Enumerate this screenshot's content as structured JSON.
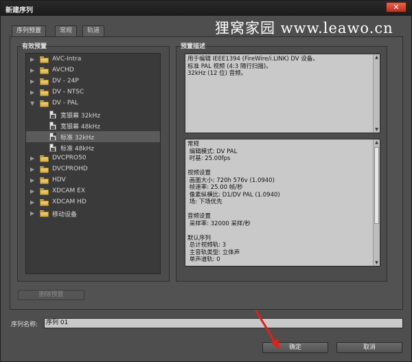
{
  "window": {
    "title": "新建序列",
    "close_label": "✕",
    "watermark": "狸窝家园  www.leawo.cn"
  },
  "tabs": [
    {
      "label": "序列预置",
      "active": true
    },
    {
      "label": "常规",
      "active": false
    },
    {
      "label": "轨道",
      "active": false
    }
  ],
  "presets": {
    "group_label": "有效预置",
    "items": [
      {
        "label": "AVC-Intra",
        "type": "folder",
        "expanded": false,
        "level": 0
      },
      {
        "label": "AVCHD",
        "type": "folder",
        "expanded": false,
        "level": 0
      },
      {
        "label": "DV - 24P",
        "type": "folder",
        "expanded": false,
        "level": 0
      },
      {
        "label": "DV - NTSC",
        "type": "folder",
        "expanded": false,
        "level": 0
      },
      {
        "label": "DV - PAL",
        "type": "folder",
        "expanded": true,
        "level": 0
      },
      {
        "label": "宽银幕 32kHz",
        "type": "file",
        "level": 1
      },
      {
        "label": "宽银幕 48kHz",
        "type": "file",
        "level": 1
      },
      {
        "label": "标准 32kHz",
        "type": "file",
        "level": 1,
        "selected": true
      },
      {
        "label": "标准 48kHz",
        "type": "file",
        "level": 1
      },
      {
        "label": "DVCPRO50",
        "type": "folder",
        "expanded": false,
        "level": 0
      },
      {
        "label": "DVCPROHD",
        "type": "folder",
        "expanded": false,
        "level": 0
      },
      {
        "label": "HDV",
        "type": "folder",
        "expanded": false,
        "level": 0
      },
      {
        "label": "XDCAM EX",
        "type": "folder",
        "expanded": false,
        "level": 0
      },
      {
        "label": "XDCAM HD",
        "type": "folder",
        "expanded": false,
        "level": 0
      },
      {
        "label": "移动设备",
        "type": "folder",
        "expanded": false,
        "level": 0
      }
    ],
    "delete_button": "删除预置"
  },
  "description": {
    "group_label": "预置描述",
    "summary_lines": [
      "用于编辑 IEEE1394 (FireWire/i.LINK) DV 设备。",
      "标准 PAL 视频 (4:3 隔行扫描)。",
      "32kHz (12 位) 音频。"
    ],
    "detail_lines": [
      "常规",
      " 编辑模式: DV PAL",
      " 时基: 25.00fps",
      "",
      "视频设置",
      " 画面大小: 720h 576v (1.0940)",
      " 帧速率: 25.00 帧/秒",
      " 像素纵横比: D1/DV PAL (1.0940)",
      " 场: 下场优先",
      "",
      "音频设置",
      " 采样率: 32000 采样/秒",
      "",
      "默认序列",
      " 总计视频轨: 3",
      " 主音轨类型: 立体声",
      " 单声道轨: 0"
    ]
  },
  "sequence_name": {
    "label": "序列名称:",
    "value": "序列 01"
  },
  "buttons": {
    "ok": "确定",
    "cancel": "取消"
  }
}
